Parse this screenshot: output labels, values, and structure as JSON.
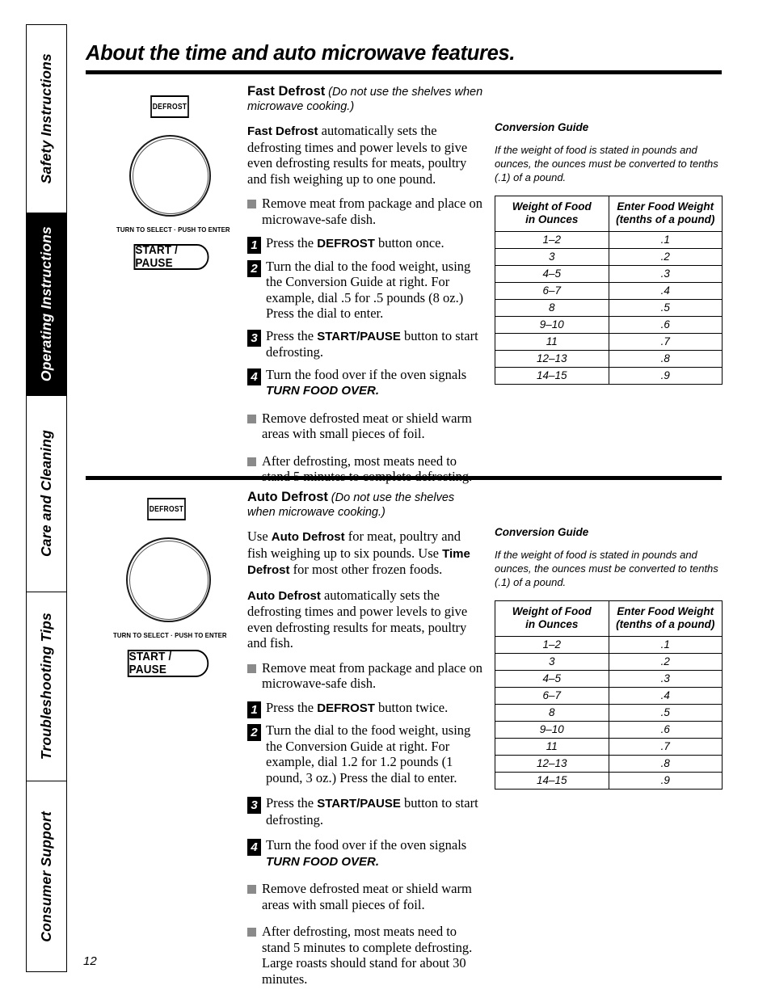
{
  "page": {
    "title": "About the time and auto microwave features.",
    "number": "12"
  },
  "sidebar": {
    "tabs": [
      {
        "label": "Safety Instructions",
        "active": false
      },
      {
        "label": "Operating Instructions",
        "active": true
      },
      {
        "label": "Care and Cleaning",
        "active": false
      },
      {
        "label": "Troubleshooting Tips",
        "active": false
      },
      {
        "label": "Consumer Support",
        "active": false
      }
    ]
  },
  "panel": {
    "defrost_label": "DEFROST",
    "dial_caption": "TURN TO SELECT  ·  PUSH TO ENTER",
    "start_pause_label": "START / PAUSE"
  },
  "sections": [
    {
      "heading_name": "Fast Defrost",
      "heading_paren": "(Do not use the shelves when microwave cooking.)",
      "intro": [
        {
          "emph": "Fast Defrost",
          "rest": "automatically sets the defrosting times and power levels to give even defrosting results for meats, poultry and fish weighing up to one pound."
        }
      ],
      "bullets_top": [
        "Remove meat from package and place on microwave-safe dish."
      ],
      "steps": [
        {
          "num": "1",
          "pre": "Press the ",
          "emph": "DEFROST",
          "post": " button once."
        },
        {
          "num": "2",
          "pre": "Turn the dial to the food weight, using the Conversion Guide at right. For example, dial .5 for .5 pounds (8 oz.) Press the dial to enter.",
          "emph": "",
          "post": ""
        },
        {
          "num": "3",
          "pre": "Press the ",
          "emph": "START/PAUSE",
          "post": " button to start defrosting."
        },
        {
          "num": "4",
          "pre": "Turn the food over if the oven signals ",
          "emph_it": "TURN FOOD OVER.",
          "post": ""
        }
      ],
      "bullets_bottom": [
        "Remove defrosted meat or shield warm areas with small pieces of foil.",
        "After defrosting, most meats need to stand 5 minutes to complete defrosting."
      ]
    },
    {
      "heading_name": "Auto Defrost",
      "heading_paren": "(Do not use the shelves when microwave cooking.)",
      "intro": [
        {
          "pre": "Use ",
          "emph": "Auto Defrost",
          "mid": " for meat, poultry and fish weighing up to six pounds. Use ",
          "emph2": "Time Defrost",
          "post": " for most other frozen foods."
        },
        {
          "emph": "Auto Defrost",
          "rest": "automatically sets the defrosting times and power levels to give even defrosting results for meats, poultry and fish."
        }
      ],
      "bullets_top": [
        "Remove meat from package and place on microwave-safe dish."
      ],
      "steps": [
        {
          "num": "1",
          "pre": "Press the ",
          "emph": "DEFROST",
          "post": " button twice."
        },
        {
          "num": "2",
          "pre": "Turn the dial to the food weight, using the Conversion Guide at right. For example, dial 1.2 for 1.2 pounds (1 pound, 3 oz.) Press the dial to enter.",
          "emph": "",
          "post": ""
        },
        {
          "num": "3",
          "pre": "Press the ",
          "emph": "START/PAUSE",
          "post": " button to start defrosting."
        },
        {
          "num": "4",
          "pre": "Turn the food over if the oven signals ",
          "emph_it": "TURN FOOD OVER.",
          "post": ""
        }
      ],
      "bullets_bottom": [
        "Remove defrosted meat or shield warm areas with small pieces of foil.",
        "After defrosting, most meats need to stand 5 minutes to complete defrosting. Large roasts should stand for about 30 minutes."
      ]
    }
  ],
  "conversion_guide": {
    "title": "Conversion Guide",
    "note": "If the weight of food is stated in pounds and ounces, the ounces must be converted to tenths (.1) of a pound.",
    "headers": [
      "Weight of Food in Ounces",
      "Enter Food Weight (tenths of a pound)"
    ],
    "header_lines": [
      [
        "Weight of Food",
        "in Ounces"
      ],
      [
        "Enter Food Weight",
        "(tenths of a pound)"
      ]
    ],
    "rows": [
      [
        "1–2",
        ".1"
      ],
      [
        "3",
        ".2"
      ],
      [
        "4–5",
        ".3"
      ],
      [
        "6–7",
        ".4"
      ],
      [
        "8",
        ".5"
      ],
      [
        "9–10",
        ".6"
      ],
      [
        "11",
        ".7"
      ],
      [
        "12–13",
        ".8"
      ],
      [
        "14–15",
        ".9"
      ]
    ]
  },
  "colors": {
    "ink": "#000000",
    "bullet_gray": "#8a8a8a",
    "paper": "#ffffff"
  }
}
